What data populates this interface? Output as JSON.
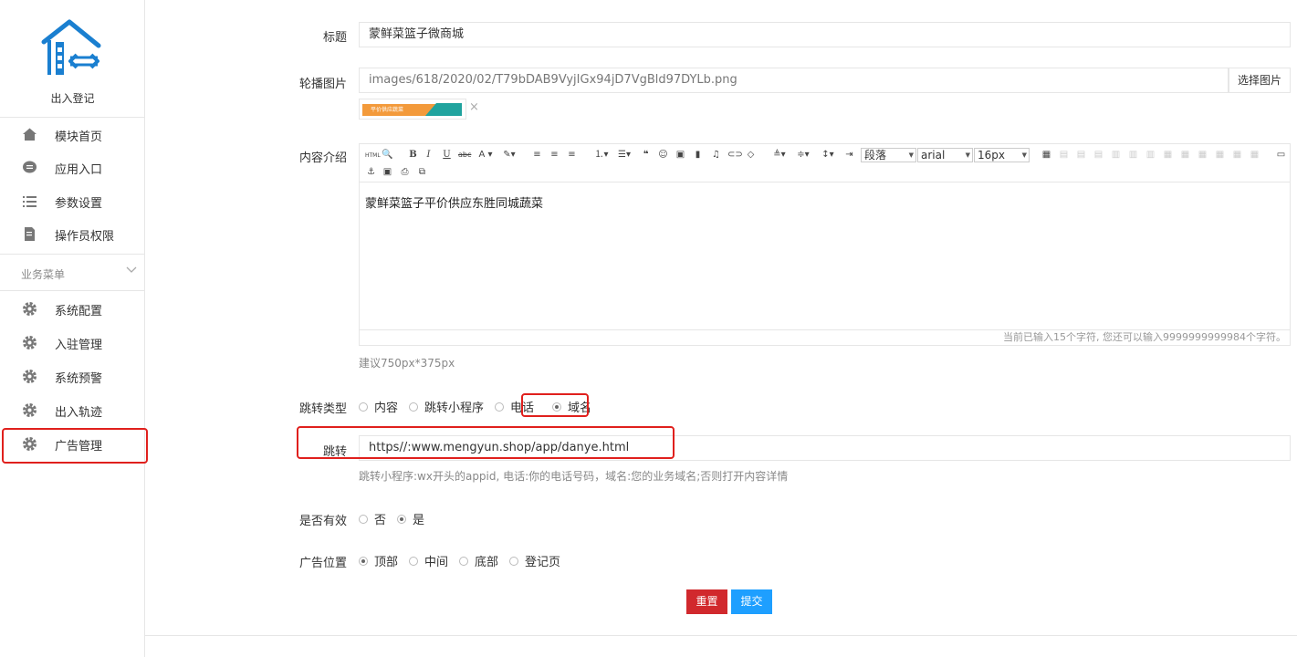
{
  "sidebar": {
    "logo_text": "出入登记",
    "items": [
      {
        "label": "模块首页",
        "icon": "home-icon"
      },
      {
        "label": "应用入口",
        "icon": "chat-icon"
      },
      {
        "label": "参数设置",
        "icon": "list-icon"
      },
      {
        "label": "操作员权限",
        "icon": "document-icon"
      }
    ],
    "section_title": "业务菜单",
    "business_items": [
      {
        "label": "系统配置",
        "icon": "gear-icon"
      },
      {
        "label": "入驻管理",
        "icon": "gear-icon"
      },
      {
        "label": "系统预警",
        "icon": "gear-icon"
      },
      {
        "label": "出入轨迹",
        "icon": "gear-icon"
      },
      {
        "label": "广告管理",
        "icon": "gear-icon",
        "active": true
      }
    ]
  },
  "form": {
    "title_label": "标题",
    "title_value": "蒙鲜菜篮子微商城",
    "carousel_label": "轮播图片",
    "carousel_value": "images/618/2020/02/T79bDAB9VyjIGx94jD7VgBld97DYLb.png",
    "choose_image_label": "选择图片",
    "thumb_text": "平价供应蔬菜",
    "thumb_close": "×",
    "content_label": "内容介绍",
    "editor": {
      "format_select": "段落",
      "font_select": "arial",
      "size_select": "16px",
      "body": "蒙鲜菜篮子平价供应东胜同城蔬菜",
      "footer": "当前已输入15个字符, 您还可以输入9999999999984个字符。"
    },
    "size_hint": "建议750px*375px",
    "jump_type_label": "跳转类型",
    "jump_type_options": [
      "内容",
      "跳转小程序",
      "电话",
      "域名"
    ],
    "jump_type_selected": "域名",
    "jump_label": "跳转",
    "jump_value": "https//:www.mengyun.shop/app/danye.html",
    "jump_hint": "跳转小程序:wx开头的appid, 电话:你的电话号码，域名:您的业务域名;否则打开内容详情",
    "valid_label": "是否有效",
    "valid_options": [
      "否",
      "是"
    ],
    "valid_selected": "是",
    "position_label": "广告位置",
    "position_options": [
      "顶部",
      "中间",
      "底部",
      "登记页"
    ],
    "position_selected": "顶部",
    "reset_label": "重置",
    "submit_label": "提交"
  },
  "colors": {
    "logo_blue": "#1a7fd0",
    "highlight_red": "#e0201d",
    "reset_red": "#d1292d",
    "submit_blue": "#1e9fff"
  }
}
